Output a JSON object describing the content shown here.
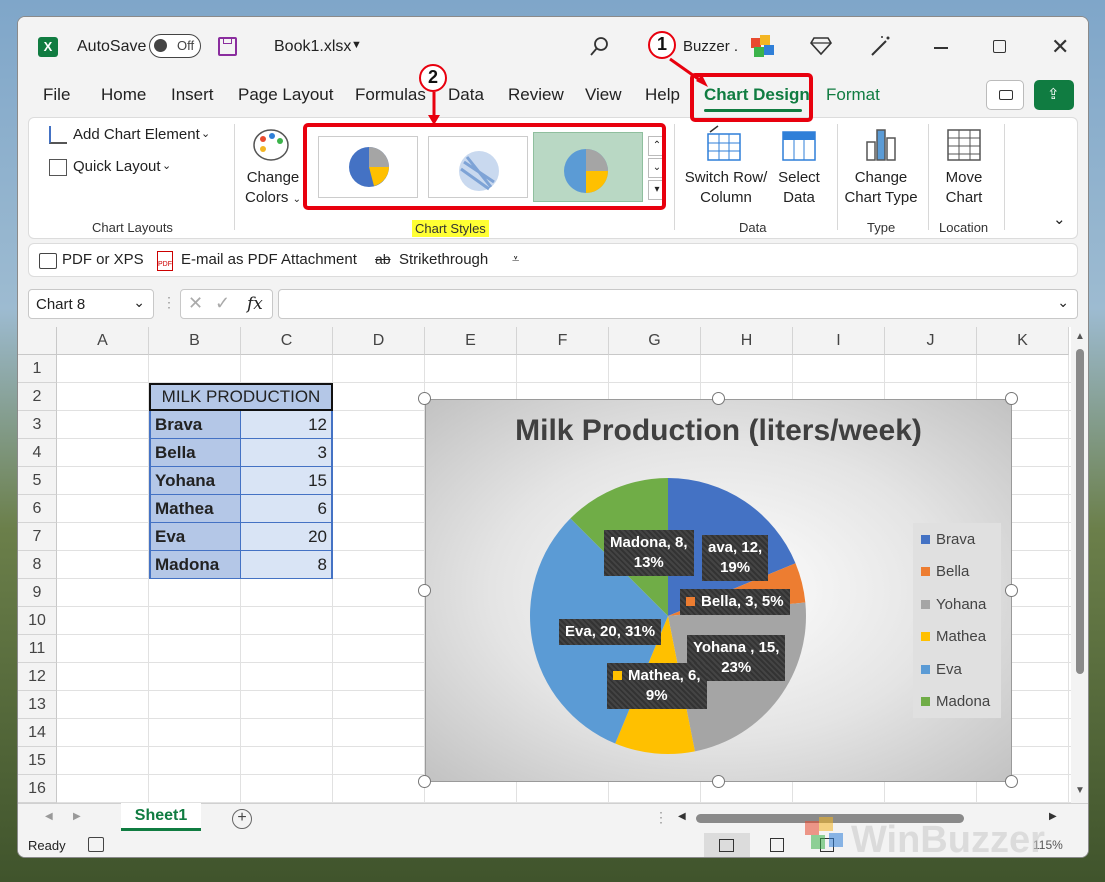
{
  "titlebar": {
    "autosave_label": "AutoSave",
    "autosave_state": "Off",
    "filename": "Book1.xlsx",
    "user": "Buzzer ."
  },
  "tabs": [
    "File",
    "Home",
    "Insert",
    "Page Layout",
    "Formulas",
    "Data",
    "Review",
    "View",
    "Help",
    "Chart Design",
    "Format"
  ],
  "active_tab": "Chart Design",
  "ribbon": {
    "add_chart_element": "Add Chart Element",
    "quick_layout": "Quick Layout",
    "chart_layouts_label": "Chart Layouts",
    "change_colors_1": "Change",
    "change_colors_2": "Colors",
    "chart_styles_label": "Chart Styles",
    "switch_1": "Switch Row/",
    "switch_2": "Column",
    "select_1": "Select",
    "select_2": "Data",
    "data_label": "Data",
    "change_type_1": "Change",
    "change_type_2": "Chart Type",
    "type_label": "Type",
    "move_1": "Move",
    "move_2": "Chart",
    "location_label": "Location"
  },
  "qat": {
    "pdf_xps": "PDF or XPS",
    "email_pdf": "E-mail as PDF Attachment",
    "strikethrough": "Strikethrough"
  },
  "formula_bar": {
    "name_box": "Chart 8",
    "fx": "fx",
    "value": ""
  },
  "columns": [
    "A",
    "B",
    "C",
    "D",
    "E",
    "F",
    "G",
    "H",
    "I",
    "J",
    "K"
  ],
  "rows": [
    "1",
    "2",
    "3",
    "4",
    "5",
    "6",
    "7",
    "8",
    "9",
    "10",
    "11",
    "12",
    "13",
    "14",
    "15",
    "16"
  ],
  "table": {
    "header": "MILK PRODUCTION",
    "names": [
      "Brava",
      "Bella",
      "Yohana",
      "Mathea",
      "Eva",
      "Madona"
    ],
    "values": [
      "12",
      "3",
      "15",
      "6",
      "20",
      "8"
    ]
  },
  "chart_data": {
    "type": "pie",
    "title": "Milk Production (liters/week)",
    "categories": [
      "Brava",
      "Bella",
      "Yohana",
      "Mathea",
      "Eva",
      "Madona"
    ],
    "values": [
      12,
      3,
      15,
      6,
      20,
      8
    ],
    "colors": [
      "#4472c4",
      "#ed7d31",
      "#a5a5a5",
      "#ffc000",
      "#5b9bd5",
      "#70ad47"
    ],
    "data_labels": [
      "ava, 12, 19%",
      "Bella, 3, 5%",
      "Yohana , 15, 23%",
      "Mathea, 6, 9%",
      "Eva, 20, 31%",
      "Madona, 8, 13%"
    ],
    "legend_position": "right"
  },
  "labels_split": {
    "brava_1": "ava, 12,",
    "brava_2": "19%",
    "bella": "Bella, 3, 5%",
    "yohana_1": "Yohana , 15,",
    "yohana_2": "23%",
    "mathea_1": "Mathea, 6,",
    "mathea_2": "9%",
    "eva": "Eva, 20, 31%",
    "madona_1": "Madona, 8,",
    "madona_2": "13%"
  },
  "sheetbar": {
    "sheet": "Sheet1"
  },
  "status": {
    "ready": "Ready",
    "zoom": "115%"
  },
  "callouts": [
    "1",
    "2"
  ],
  "watermark": "WinBuzzer"
}
